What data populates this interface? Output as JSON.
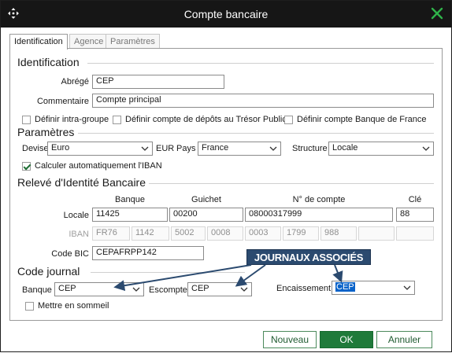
{
  "window": {
    "title": "Compte bancaire"
  },
  "tabs": [
    {
      "label": "Identification",
      "active": true
    },
    {
      "label": "Agence",
      "active": false
    },
    {
      "label": "Paramètres",
      "active": false
    }
  ],
  "identification": {
    "heading": "Identification",
    "abrege_label": "Abrégé",
    "abrege_value": "CEP",
    "commentaire_label": "Commentaire",
    "commentaire_value": "Compte principal",
    "checkboxes": [
      {
        "label": "Définir intra-groupe",
        "checked": false
      },
      {
        "label": "Définir compte de dépôts au Trésor Public",
        "checked": false
      },
      {
        "label": "Définir compte Banque de France",
        "checked": false
      }
    ]
  },
  "parametres": {
    "heading": "Paramètres",
    "devise_label": "Devise",
    "devise_value": "Euro",
    "devise_code": "EUR",
    "pays_label": "Pays",
    "pays_value": "France",
    "structure_label": "Structure",
    "structure_value": "Locale",
    "iban_auto_label": "Calculer automatiquement l'IBAN",
    "iban_auto_checked": true
  },
  "rib": {
    "heading": "Relevé d'Identité Bancaire",
    "columns": {
      "banque": "Banque",
      "guichet": "Guichet",
      "compte": "N° de compte",
      "cle": "Clé"
    },
    "locale_label": "Locale",
    "locale": {
      "banque": "11425",
      "guichet": "00200",
      "compte": "08000317999",
      "cle": "88"
    },
    "iban_label": "IBAN",
    "iban_parts": [
      "FR76",
      "1142",
      "5002",
      "0008",
      "0003",
      "1799",
      "988",
      "",
      ""
    ],
    "bic_label": "Code BIC",
    "bic_value": "CEPAFRPP142"
  },
  "code_journal": {
    "heading": "Code journal",
    "banque_label": "Banque",
    "banque_value": "CEP",
    "escompte_label": "Escompte",
    "escompte_value": "CEP",
    "encaissement_label": "Encaissement",
    "encaissement_value": "CEP",
    "sommeil_label": "Mettre en sommeil",
    "sommeil_checked": false
  },
  "annotation": {
    "text": "JOURNAUX ASSOCIÉS"
  },
  "buttons": {
    "nouveau": "Nouveau",
    "ok": "OK",
    "annuler": "Annuler"
  },
  "colors": {
    "titlebar": "#161616",
    "accent_green": "#1f7a3a",
    "callout_bg": "#2b4a6f",
    "selection": "#0a63c9"
  }
}
